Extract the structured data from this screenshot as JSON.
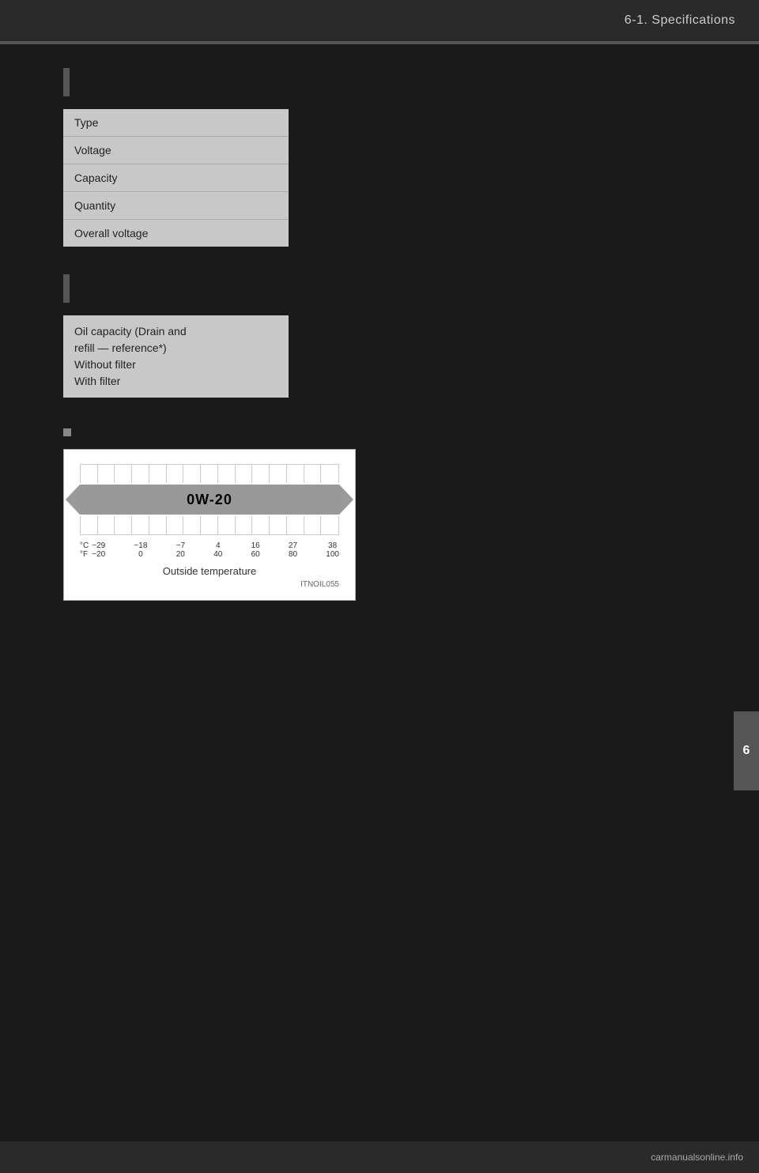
{
  "header": {
    "title": "6-1.  Specifications"
  },
  "section1": {
    "table_rows": [
      "Type",
      "Voltage",
      "Capacity",
      "Quantity",
      "Overall voltage"
    ]
  },
  "section2": {
    "oil_capacity_label": "Oil capacity (Drain and\nrefill — reference*)\nWithout filter\nWith filter"
  },
  "chart": {
    "oil_grade": "0W-20",
    "outside_temp_label": "Outside temperature",
    "image_code": "ITNOIL055",
    "celsius_label": "°C",
    "fahrenheit_label": "°F",
    "temp_pairs": [
      {
        "c": "−29",
        "f": "−20"
      },
      {
        "c": "−18",
        "f": "0"
      },
      {
        "c": "−7",
        "f": "20"
      },
      {
        "c": "4",
        "f": "40"
      },
      {
        "c": "16",
        "f": "60"
      },
      {
        "c": "27",
        "f": "80"
      },
      {
        "c": "38",
        "f": "100"
      }
    ]
  },
  "side_tab": {
    "number": "6"
  },
  "bottom": {
    "logo": "carmanualsonline.info"
  }
}
